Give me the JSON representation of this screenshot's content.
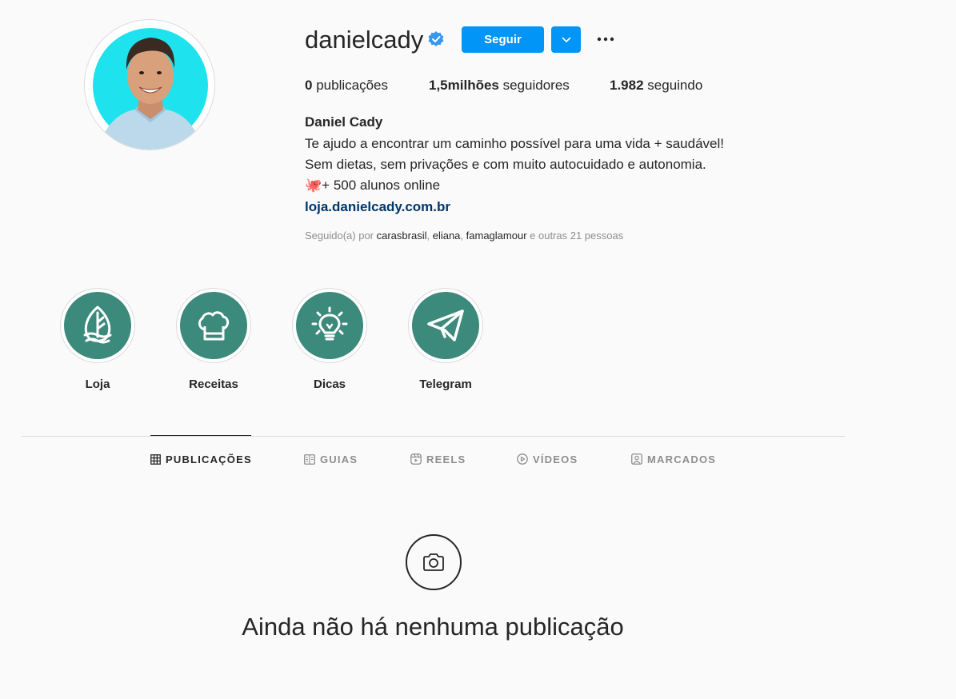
{
  "profile": {
    "username": "danielcady",
    "follow_label": "Seguir",
    "stats": [
      {
        "value": "0",
        "label": "publicações"
      },
      {
        "value": "1,5milhões",
        "label": "seguidores"
      },
      {
        "value": "1.982",
        "label": "seguindo"
      }
    ],
    "full_name": "Daniel Cady",
    "bio_lines": [
      "Te ajudo a encontrar um caminho possível para uma vida + saudável!",
      "Sem dietas, sem privações e com muito autocuidado e autonomia.",
      "🐙+ 500 alunos online"
    ],
    "link": "loja.danielcady.com.br",
    "followed_by": {
      "prefix": "Seguido(a) por ",
      "names": [
        "carasbrasil",
        "eliana",
        "famaglamour"
      ],
      "suffix": " e outras 21 pessoas"
    }
  },
  "highlights": [
    {
      "label": "Loja",
      "icon": "leaf-icon"
    },
    {
      "label": "Receitas",
      "icon": "chef-hat-icon"
    },
    {
      "label": "Dicas",
      "icon": "lightbulb-icon"
    },
    {
      "label": "Telegram",
      "icon": "paper-plane-icon"
    }
  ],
  "tabs": [
    {
      "label": "PUBLICAÇÕES",
      "icon": "grid-icon",
      "active": true
    },
    {
      "label": "GUIAS",
      "icon": "guide-icon",
      "active": false
    },
    {
      "label": "REELS",
      "icon": "reels-icon",
      "active": false
    },
    {
      "label": "VÍDEOS",
      "icon": "play-icon",
      "active": false
    },
    {
      "label": "MARCADOS",
      "icon": "tagged-icon",
      "active": false
    }
  ],
  "empty_state": {
    "icon": "camera-icon",
    "title": "Ainda não há nenhuma publicação"
  },
  "colors": {
    "accent": "#0095f6",
    "highlight": "#3c8a7b",
    "link": "#00376b",
    "avatar_bg": "#1ee3ee"
  }
}
